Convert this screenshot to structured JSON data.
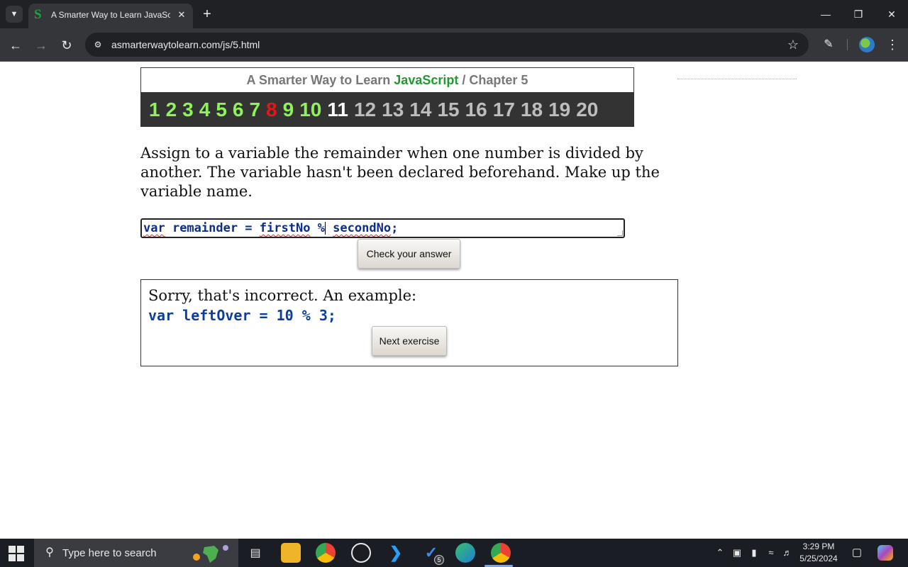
{
  "browser": {
    "tab_title": "A Smarter Way to Learn JavaScript",
    "tab_favicon": "S",
    "url": "asmarterwaytolearn.com/js/5.html"
  },
  "header": {
    "title_prefix": "A Smarter Way to Learn",
    "title_accent": "JavaScript",
    "separator": "/",
    "chapter": "Chapter 5",
    "accent_color": "#1e9b2f"
  },
  "exercises": {
    "items": [
      {
        "num": "1",
        "state": "done"
      },
      {
        "num": "2",
        "state": "done"
      },
      {
        "num": "3",
        "state": "done"
      },
      {
        "num": "4",
        "state": "done"
      },
      {
        "num": "5",
        "state": "done"
      },
      {
        "num": "6",
        "state": "done"
      },
      {
        "num": "7",
        "state": "done"
      },
      {
        "num": "8",
        "state": "current"
      },
      {
        "num": "9",
        "state": "done"
      },
      {
        "num": "10",
        "state": "done"
      },
      {
        "num": "11",
        "state": "next"
      },
      {
        "num": "12",
        "state": "future"
      },
      {
        "num": "13",
        "state": "future"
      },
      {
        "num": "14",
        "state": "future"
      },
      {
        "num": "15",
        "state": "future"
      },
      {
        "num": "16",
        "state": "future"
      },
      {
        "num": "17",
        "state": "future"
      },
      {
        "num": "18",
        "state": "future"
      },
      {
        "num": "19",
        "state": "future"
      },
      {
        "num": "20",
        "state": "future"
      }
    ]
  },
  "exercise": {
    "prompt": "Assign to a variable the remainder when one number is divided by another. The variable hasn't been declared beforehand. Make up the variable name.",
    "answer_value": "var remainder = firstNo % secondNo;",
    "check_label": "Check your answer"
  },
  "feedback": {
    "message": "Sorry, that's incorrect. An example:",
    "example_code": "var leftOver = 10 % 3;",
    "next_label": "Next exercise"
  },
  "taskbar": {
    "search_placeholder": "Type here to search",
    "time": "3:29 PM",
    "date": "5/25/2024",
    "todo_badge": "5"
  }
}
